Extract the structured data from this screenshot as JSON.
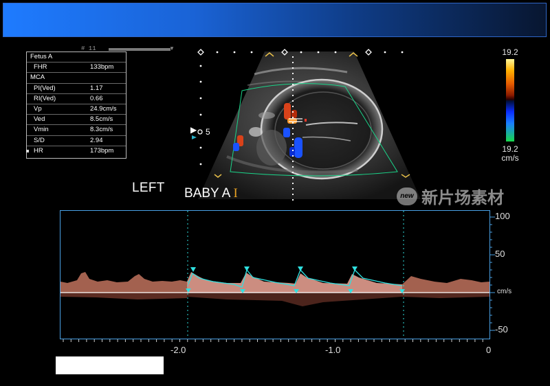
{
  "header": {
    "accent": "#1e7bff"
  },
  "top_indicator": "# 11",
  "measurements": {
    "header": "Fetus A",
    "rows": [
      {
        "label": "FHR",
        "value": "133bpm"
      },
      {
        "label": "MCA",
        "value": ""
      },
      {
        "label": "PI(Ved)",
        "value": "1.17"
      },
      {
        "label": "RI(Ved)",
        "value": "0.66"
      },
      {
        "label": "Vp",
        "value": "24.9cm/s"
      },
      {
        "label": "Ved",
        "value": "8.5cm/s"
      },
      {
        "label": "Vmin",
        "value": "8.3cm/s"
      },
      {
        "label": "S/D",
        "value": "2.94"
      },
      {
        "label": "HR",
        "value": "173bpm"
      }
    ]
  },
  "color_scale": {
    "top": "19.2",
    "bottom": "19.2",
    "unit": "cm/s"
  },
  "image_labels": {
    "side": "LEFT",
    "baby": "BABY A",
    "cursor_glyph": "I",
    "depth": "5"
  },
  "watermark": {
    "logo": "new",
    "text": "新片场素材"
  },
  "doppler": {
    "y_ticks": [
      "100",
      "50",
      "-50"
    ],
    "y_unit": "cm/s",
    "x_ticks": [
      "-2.0",
      "-1.0",
      "0"
    ],
    "baseline_color": "#ffffff",
    "trace_color": "#2fe0e0",
    "spectrum_color": "#ffb0a0"
  }
}
